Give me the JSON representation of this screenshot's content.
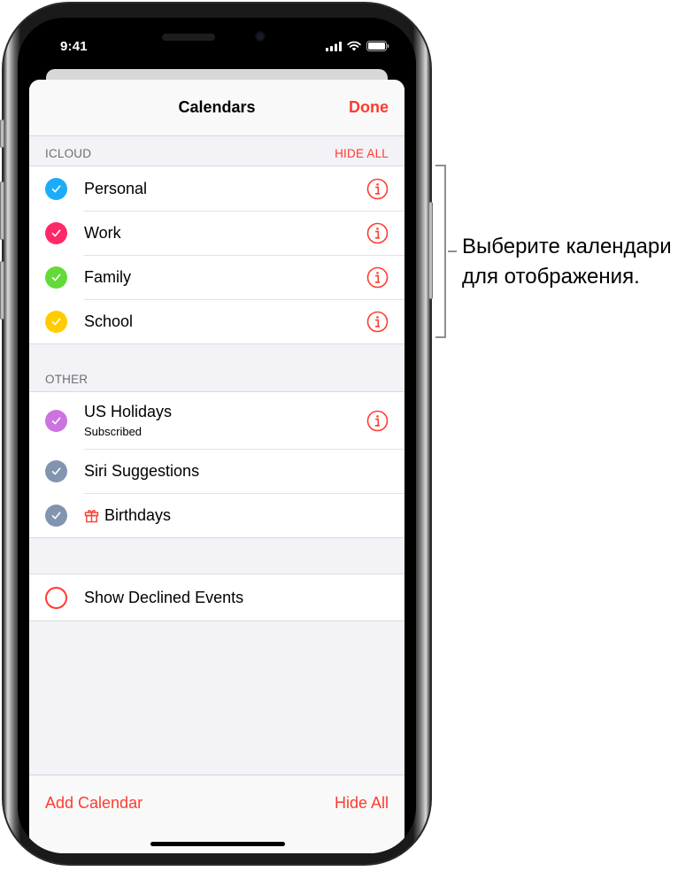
{
  "status_bar": {
    "time": "9:41",
    "icons": [
      "cellular-signal-icon",
      "wifi-icon",
      "battery-icon"
    ]
  },
  "navbar": {
    "title": "Calendars",
    "done_label": "Done"
  },
  "sections": {
    "icloud": {
      "header": "ICLOUD",
      "hide_all_label": "HIDE ALL",
      "items": [
        {
          "label": "Personal",
          "color": "#1badf8",
          "checked": true,
          "has_info": true
        },
        {
          "label": "Work",
          "color": "#ff2968",
          "checked": true,
          "has_info": true
        },
        {
          "label": "Family",
          "color": "#63da38",
          "checked": true,
          "has_info": true
        },
        {
          "label": "School",
          "color": "#ffcc00",
          "checked": true,
          "has_info": true
        }
      ]
    },
    "other": {
      "header": "OTHER",
      "items": [
        {
          "label": "US Holidays",
          "subtitle": "Subscribed",
          "color": "#cc73e1",
          "checked": true,
          "has_info": true
        },
        {
          "label": "Siri Suggestions",
          "color": "#8295af",
          "checked": true,
          "has_info": false
        },
        {
          "label": "Birthdays",
          "color": "#8295af",
          "checked": true,
          "has_info": false,
          "icon": "gift-icon"
        }
      ]
    },
    "options": {
      "items": [
        {
          "label": "Show Declined Events",
          "checked": false
        }
      ]
    }
  },
  "toolbar": {
    "add_calendar_label": "Add Calendar",
    "hide_all_label": "Hide All"
  },
  "callout": {
    "text": "Выберите календари для отображения."
  },
  "colors": {
    "accent": "#ff3b30",
    "grouped_background": "#f2f2f7",
    "section_header_text": "#6d6d72"
  }
}
